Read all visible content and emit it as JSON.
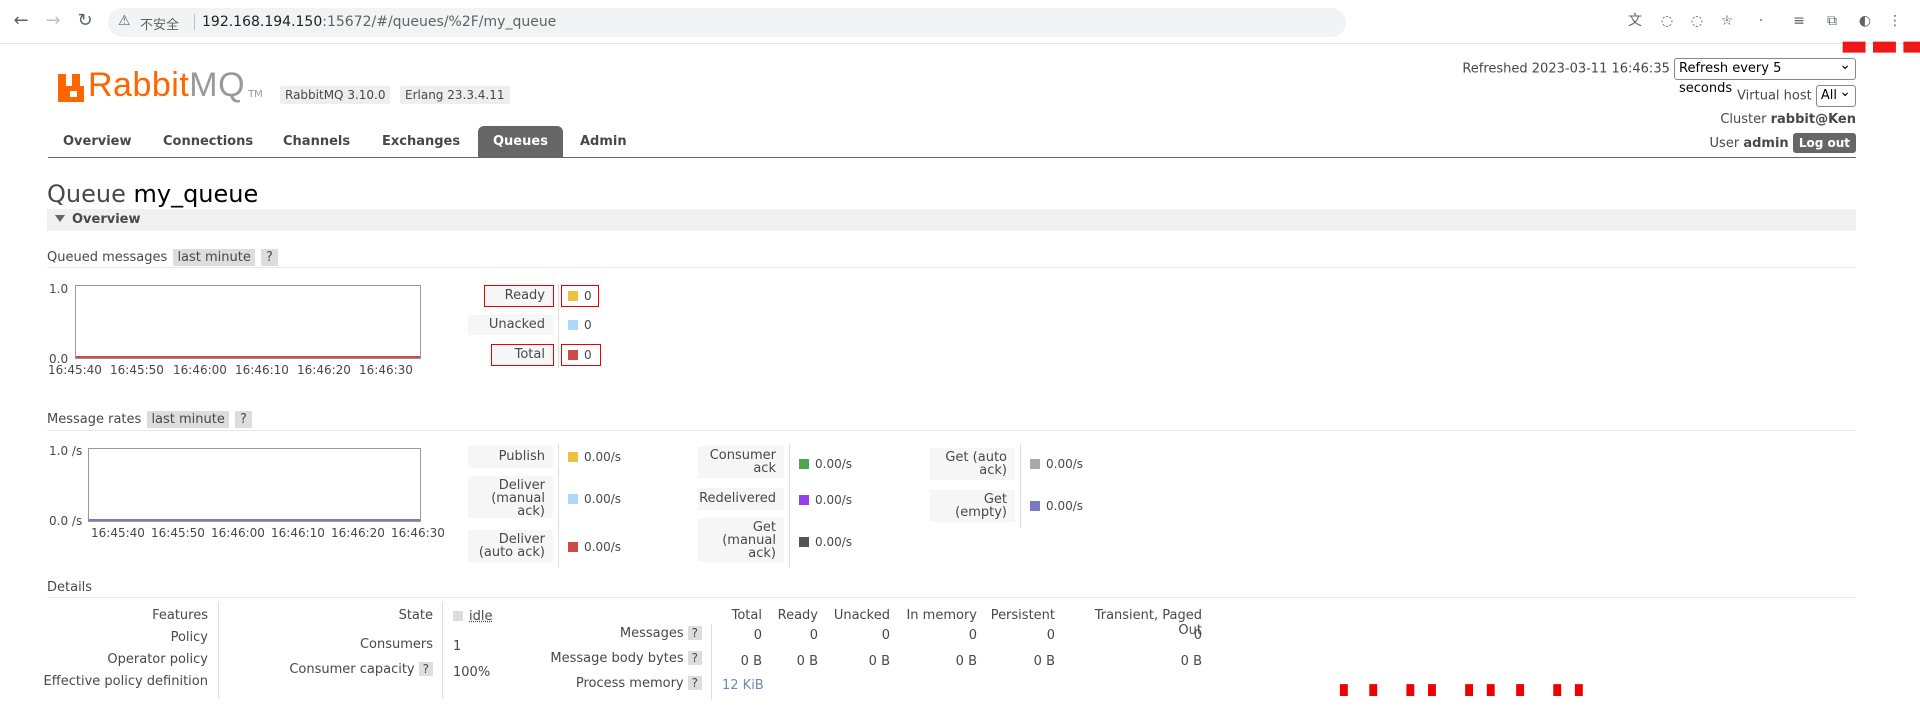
{
  "browser": {
    "insecure_label": "不安全",
    "url_host": "192.168.194.150",
    "url_rest": ":15672/#/queues/%2F/my_queue"
  },
  "header": {
    "logo_rabbit": "Rabbit",
    "logo_mq": "MQ",
    "logo_tm": "TM",
    "version_badge": "RabbitMQ 3.10.0",
    "erlang_badge": "Erlang 23.3.4.11",
    "refreshed_label": "Refreshed 2023-03-11 16:46:35",
    "refresh_select": "Refresh every 5 seconds",
    "vhost_label": "Virtual host",
    "vhost_select": "All",
    "cluster_label": "Cluster",
    "cluster_name": "rabbit@Ken",
    "user_label": "User",
    "user_name": "admin",
    "logout_label": "Log out"
  },
  "tabs": [
    "Overview",
    "Connections",
    "Channels",
    "Exchanges",
    "Queues",
    "Admin"
  ],
  "page_title_prefix": "Queue",
  "page_title_name": "my_queue",
  "overview_section": "Overview",
  "queued_messages": {
    "title": "Queued messages",
    "range_tag": "last minute",
    "help": "?",
    "y_max": "1.0",
    "y_min": "0.0",
    "ticks": [
      "16:45:40",
      "16:45:50",
      "16:46:00",
      "16:46:10",
      "16:46:20",
      "16:46:30"
    ],
    "legend": [
      {
        "label": "Ready",
        "value": "0",
        "color": "#edc240"
      },
      {
        "label": "Unacked",
        "value": "0",
        "color": "#afd8f8"
      },
      {
        "label": "Total",
        "value": "0",
        "color": "#cb4b4b"
      }
    ]
  },
  "message_rates": {
    "title": "Message rates",
    "range_tag": "last minute",
    "help": "?",
    "y_max": "1.0 /s",
    "y_min": "0.0 /s",
    "ticks": [
      "16:45:40",
      "16:45:50",
      "16:46:00",
      "16:46:10",
      "16:46:20",
      "16:46:30"
    ],
    "col1": [
      {
        "l1": "Publish",
        "l2": "",
        "l3": "",
        "value": "0.00/s",
        "color": "#edc240"
      },
      {
        "l1": "Deliver",
        "l2": "(manual",
        "l3": "ack)",
        "value": "0.00/s",
        "color": "#afd8f8"
      },
      {
        "l1": "Deliver",
        "l2": "(auto ack)",
        "l3": "",
        "value": "0.00/s",
        "color": "#cb4b4b"
      }
    ],
    "col2": [
      {
        "l1": "Consumer",
        "l2": "ack",
        "l3": "",
        "value": "0.00/s",
        "color": "#4da74d"
      },
      {
        "l1": "Redelivered",
        "l2": "",
        "l3": "",
        "value": "0.00/s",
        "color": "#9440ed"
      },
      {
        "l1": "Get",
        "l2": "(manual",
        "l3": "ack)",
        "value": "0.00/s",
        "color": "#555555"
      }
    ],
    "col3": [
      {
        "l1": "Get (auto",
        "l2": "ack)",
        "l3": "",
        "value": "0.00/s",
        "color": "#aaaaaa"
      },
      {
        "l1": "Get",
        "l2": "(empty)",
        "l3": "",
        "value": "0.00/s",
        "color": "#7c79c3"
      }
    ]
  },
  "details": {
    "title": "Details",
    "left_labels": [
      "Features",
      "Policy",
      "Operator policy",
      "Effective policy definition"
    ],
    "state_label": "State",
    "state_value": "idle",
    "consumers_label": "Consumers",
    "consumers_value": "1",
    "capacity_label": "Consumer capacity",
    "capacity_value": "100%",
    "help": "?",
    "table_headers": [
      "Total",
      "Ready",
      "Unacked",
      "In memory",
      "Persistent",
      "Transient, Paged Out"
    ],
    "messages_label": "Messages",
    "messages_values": [
      "0",
      "0",
      "0",
      "0",
      "0",
      "0"
    ],
    "body_label": "Message body bytes",
    "body_values": [
      "0 B",
      "0 B",
      "0 B",
      "0 B",
      "0 B",
      "0 B"
    ],
    "process_label": "Process memory",
    "process_value": "12 KiB"
  }
}
